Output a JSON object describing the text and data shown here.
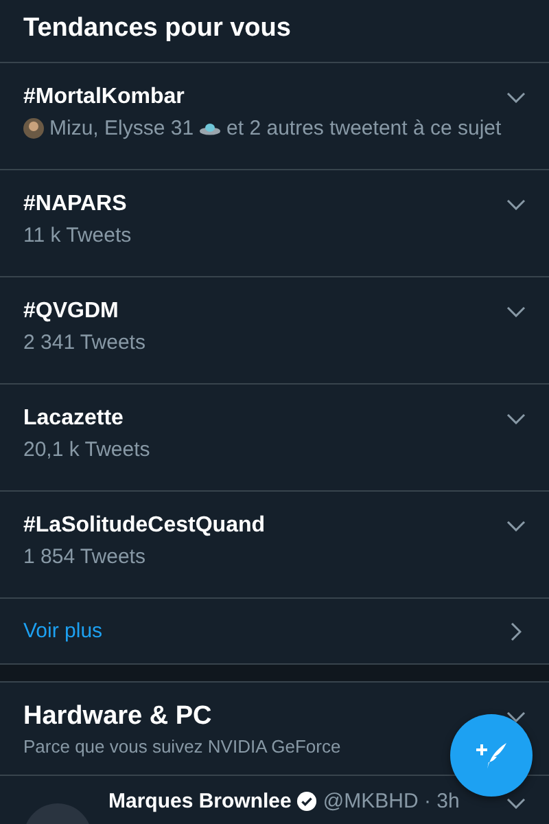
{
  "header": {
    "title": "Tendances pour vous"
  },
  "trends": [
    {
      "kind": "context",
      "name": "#MortalKombar",
      "names": "Mizu, Elysse 31",
      "rest": "et 2 autres tweetent à ce sujet"
    },
    {
      "kind": "count",
      "name": "#NAPARS",
      "count": "11 k Tweets"
    },
    {
      "kind": "count",
      "name": "#QVGDM",
      "count": "2 341 Tweets"
    },
    {
      "kind": "count",
      "name": "Lacazette",
      "count": "20,1 k Tweets"
    },
    {
      "kind": "count",
      "name": "#LaSolitudeCestQuand",
      "count": "1 854 Tweets"
    }
  ],
  "more_link": "Voir plus",
  "topic": {
    "title": "Hardware & PC",
    "subtitle": "Parce que vous suivez NVIDIA GeForce"
  },
  "tweet": {
    "author": "Marques Brownlee",
    "verified": true,
    "handle": "@MKBHD · 3h"
  }
}
